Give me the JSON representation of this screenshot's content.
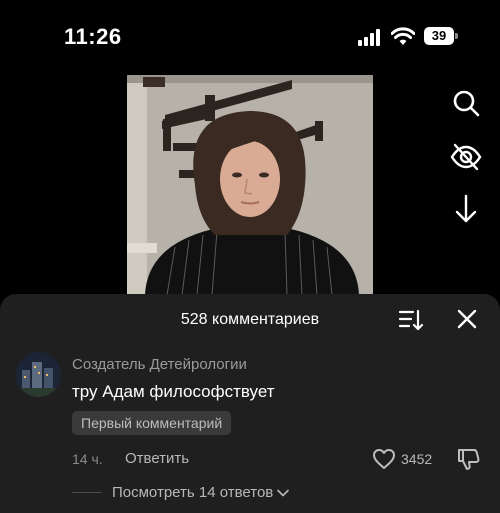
{
  "status_bar": {
    "time": "11:26",
    "battery": "39"
  },
  "video": {
    "person": "young man with shoulder-length hair in dark striped sweater",
    "background": "grey wall with dark wall shelves"
  },
  "side_actions": [
    "search-icon",
    "hide-icon",
    "download-icon"
  ],
  "comments_sheet": {
    "title": "528 комментариев",
    "comment": {
      "author": "Создатель Детейрологии",
      "text": "тру Адам философствует",
      "badge": "Первый комментарий",
      "time": "14 ч.",
      "reply_label": "Ответить",
      "likes": "3452",
      "view_replies": "Посмотреть 14 ответов"
    }
  },
  "colors": {
    "sheet_bg": "#1f1f1f",
    "muted_text": "#9a9a9a",
    "badge_bg": "#3a3a3a"
  }
}
